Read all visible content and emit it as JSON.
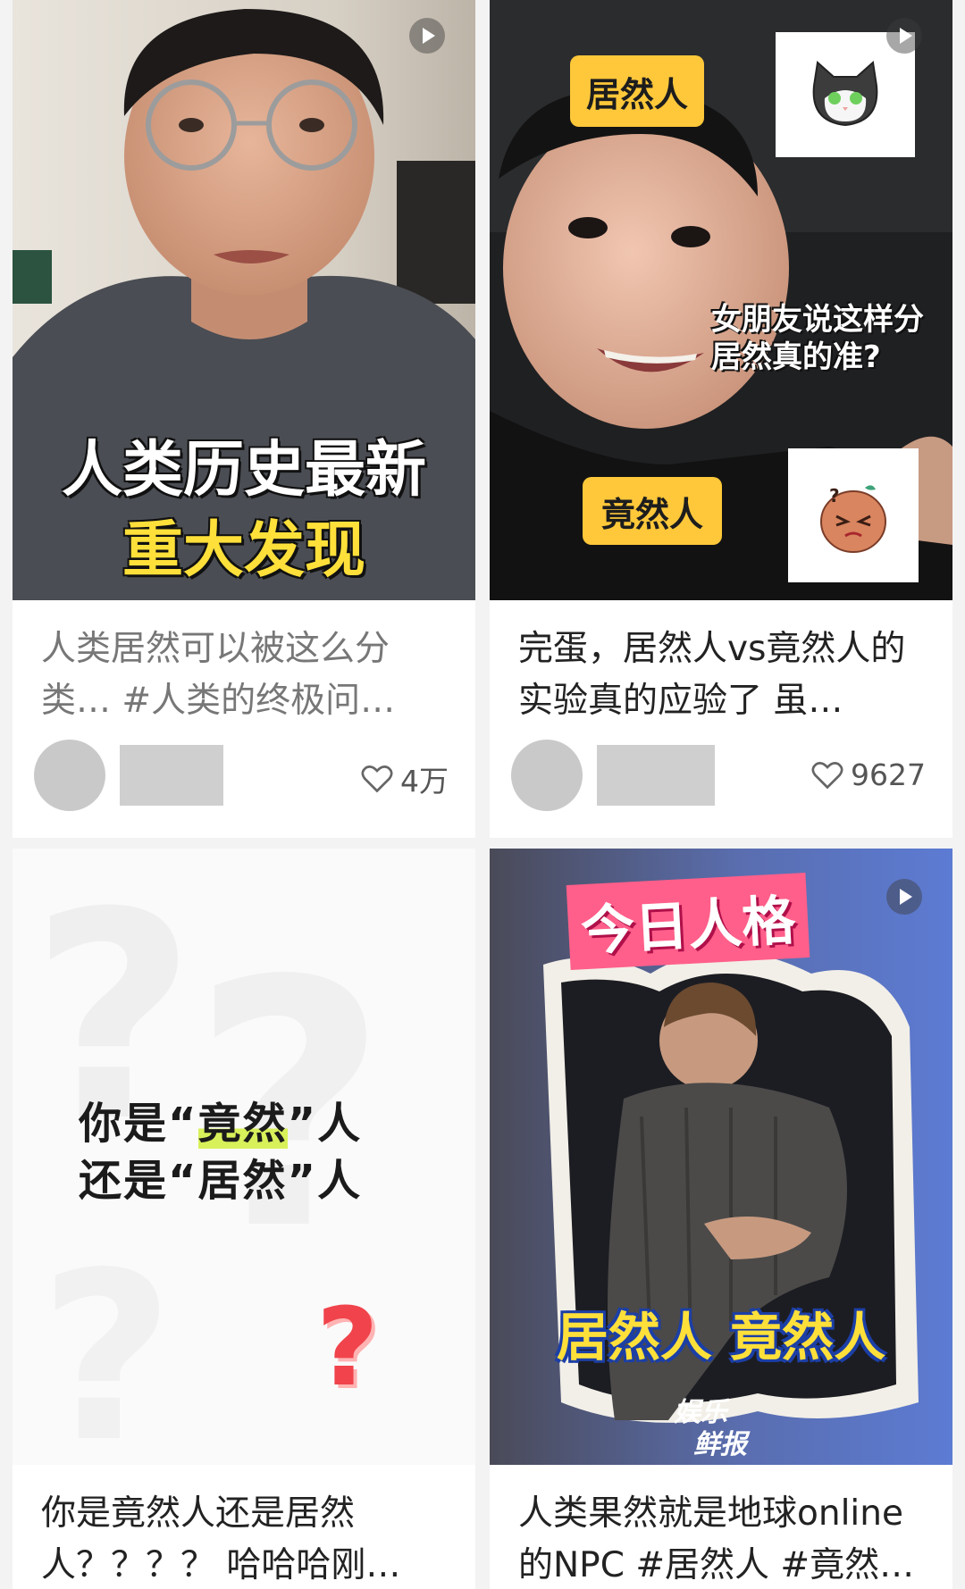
{
  "cards": [
    {
      "thumb_caption_line1": "人类历史最新",
      "thumb_caption_line2": "重大发现",
      "title": "人类居然可以被这么分类… #人类的终极问…",
      "likes": "4万"
    },
    {
      "badge_top": "居然人",
      "badge_bottom": "竟然人",
      "thumb_overlay_line1": "女朋友说这样分",
      "thumb_overlay_line2": "居然真的准?",
      "title": "完蛋，居然人vs竟然人的实验真的应验了 虽…",
      "likes": "9627"
    },
    {
      "poster_line1_a": "你是“",
      "poster_line1_hl": "竟然",
      "poster_line1_b": "”人",
      "poster_line2": "还是“居然”人",
      "poster_mark": "?",
      "title": "你是竟然人还是居然人？？？？ 哈哈哈刚…"
    },
    {
      "banner": "今日人格",
      "bottom_caption": "居然人 竟然人",
      "watermark_line1": "娱乐",
      "watermark_line2": "鲜报",
      "title": "人类果然就是地球online的NPC #居然人 #竟然…"
    }
  ],
  "icons": {
    "play": "play-icon",
    "like": "heart-icon"
  }
}
